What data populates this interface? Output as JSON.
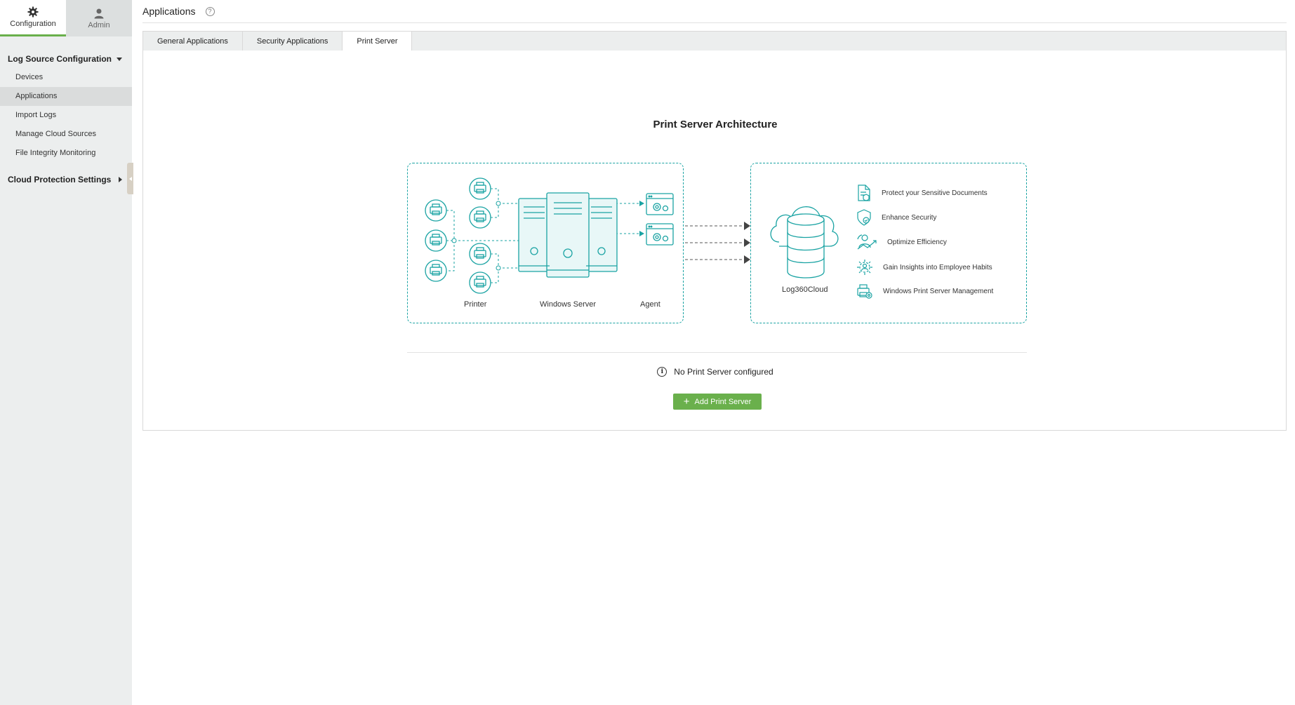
{
  "top_tabs": [
    {
      "label": "Configuration",
      "icon": "gear-icon"
    },
    {
      "label": "Admin",
      "icon": "user-icon"
    }
  ],
  "sidebar": {
    "group1": {
      "label": "Log Source Configuration",
      "expanded": true
    },
    "items": [
      {
        "label": "Devices"
      },
      {
        "label": "Applications"
      },
      {
        "label": "Import Logs"
      },
      {
        "label": "Manage Cloud Sources"
      },
      {
        "label": "File Integrity Monitoring"
      }
    ],
    "group2": {
      "label": "Cloud Protection Settings",
      "expanded": false
    }
  },
  "header": {
    "title": "Applications",
    "help_glyph": "?"
  },
  "tabs": [
    {
      "label": "General Applications"
    },
    {
      "label": "Security Applications"
    },
    {
      "label": "Print Server"
    }
  ],
  "diagram": {
    "title": "Print Server Architecture",
    "labels": {
      "printer": "Printer",
      "server": "Windows Server",
      "agent": "Agent",
      "cloud": "Log360Cloud"
    },
    "benefits": [
      {
        "label": "Protect your Sensitive Documents",
        "icon": "document-icon"
      },
      {
        "label": "Enhance Security",
        "icon": "shield-icon"
      },
      {
        "label": "Optimize Efficiency",
        "icon": "efficiency-icon"
      },
      {
        "label": "Gain Insights into Employee Habits",
        "icon": "insights-icon"
      },
      {
        "label": "Windows Print Server Management",
        "icon": "print-management-icon"
      }
    ]
  },
  "status": {
    "message": "No Print Server configured",
    "info_glyph": "i"
  },
  "add_button": {
    "label": "Add Print Server",
    "plus": "+"
  },
  "colors": {
    "accent": "#6ab04c",
    "diagram": "#1aa3a3"
  }
}
